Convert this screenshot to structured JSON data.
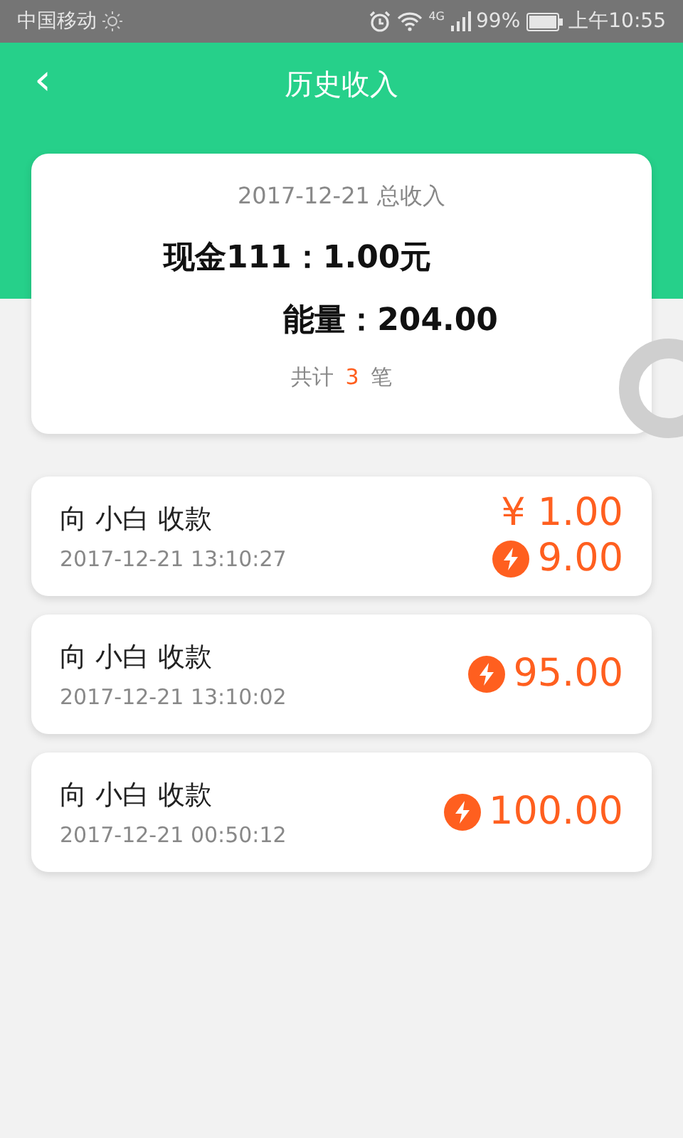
{
  "status_bar": {
    "carrier": "中国移动",
    "network": "4G",
    "battery": "99%",
    "time": "上午10:55"
  },
  "header": {
    "back": "‹",
    "title": "历史收入"
  },
  "summary": {
    "date_label": "2017-12-21 总收入",
    "cash": "现金111：1.00元",
    "energy": "能量：204.00",
    "count_prefix": "共计",
    "count": "3",
    "count_suffix": "笔"
  },
  "records": [
    {
      "title": "向 小白 收款",
      "time": "2017-12-21 13:10:27",
      "amounts": [
        {
          "kind": "cash",
          "text": "¥ 1.00"
        },
        {
          "kind": "energy",
          "text": "9.00"
        }
      ]
    },
    {
      "title": "向 小白 收款",
      "time": "2017-12-21 13:10:02",
      "amounts": [
        {
          "kind": "energy",
          "text": "95.00"
        }
      ]
    },
    {
      "title": "向 小白 收款",
      "time": "2017-12-21 00:50:12",
      "amounts": [
        {
          "kind": "energy",
          "text": "100.00"
        }
      ]
    }
  ]
}
